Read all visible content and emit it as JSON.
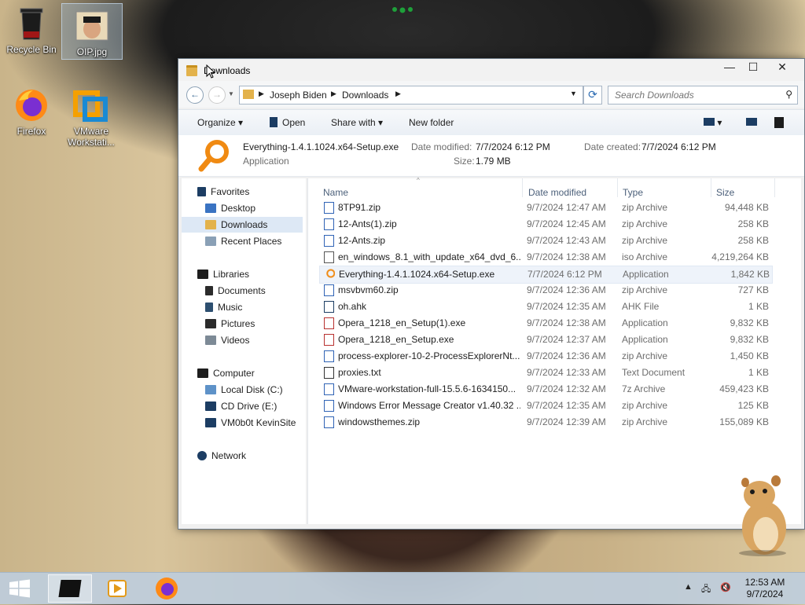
{
  "desktop": {
    "icons": [
      {
        "label": "Recycle Bin",
        "icon": "recycle-bin-icon"
      },
      {
        "label": "OIP.jpg",
        "icon": "image-file-icon"
      },
      {
        "label": "Firefox",
        "icon": "firefox-icon"
      },
      {
        "label": "VMware Workstati...",
        "icon": "vmware-icon"
      }
    ]
  },
  "window": {
    "title": "Downloads",
    "buttons": {
      "minimize": "—",
      "maximize": "☐",
      "close": "✕"
    },
    "address": {
      "segments": [
        "Joseph Biden",
        "Downloads"
      ]
    },
    "search": {
      "placeholder": "Search Downloads"
    },
    "toolbar": {
      "organize": "Organize",
      "open": "Open",
      "share_with": "Share with",
      "new_folder": "New folder"
    },
    "details": {
      "file_name": "Everything-1.4.1.1024.x64-Setup.exe",
      "file_type": "Application",
      "date_modified_label": "Date modified:",
      "date_modified": "7/7/2024 6:12 PM",
      "date_created_label": "Date created:",
      "date_created": "7/7/2024 6:12 PM",
      "size_label": "Size:",
      "size": "1.79 MB"
    },
    "nav": {
      "favorites": "Favorites",
      "desktop": "Desktop",
      "downloads": "Downloads",
      "recent_places": "Recent Places",
      "libraries": "Libraries",
      "documents": "Documents",
      "music": "Music",
      "pictures": "Pictures",
      "videos": "Videos",
      "computer": "Computer",
      "local_disk": "Local Disk (C:)",
      "cd_drive": "CD Drive (E:)",
      "share": "VM0b0t KevinSite",
      "network": "Network"
    },
    "columns": {
      "name": "Name",
      "date_modified": "Date modified",
      "type": "Type",
      "size": "Size"
    },
    "files": [
      {
        "name": "8TP91.zip",
        "date": "9/7/2024 12:47 AM",
        "type": "zip Archive",
        "size": "94,448 KB"
      },
      {
        "name": "12-Ants(1).zip",
        "date": "9/7/2024 12:45 AM",
        "type": "zip Archive",
        "size": "258 KB"
      },
      {
        "name": "12-Ants.zip",
        "date": "9/7/2024 12:43 AM",
        "type": "zip Archive",
        "size": "258 KB"
      },
      {
        "name": "en_windows_8.1_with_update_x64_dvd_6...",
        "date": "9/7/2024 12:38 AM",
        "type": "iso Archive",
        "size": "4,219,264 KB"
      },
      {
        "name": "Everything-1.4.1.1024.x64-Setup.exe",
        "date": "7/7/2024 6:12 PM",
        "type": "Application",
        "size": "1,842 KB"
      },
      {
        "name": "msvbvm60.zip",
        "date": "9/7/2024 12:36 AM",
        "type": "zip Archive",
        "size": "727 KB"
      },
      {
        "name": "oh.ahk",
        "date": "9/7/2024 12:35 AM",
        "type": "AHK File",
        "size": "1 KB"
      },
      {
        "name": "Opera_1218_en_Setup(1).exe",
        "date": "9/7/2024 12:38 AM",
        "type": "Application",
        "size": "9,832 KB"
      },
      {
        "name": "Opera_1218_en_Setup.exe",
        "date": "9/7/2024 12:37 AM",
        "type": "Application",
        "size": "9,832 KB"
      },
      {
        "name": "process-explorer-10-2-ProcessExplorerNt...",
        "date": "9/7/2024 12:36 AM",
        "type": "zip Archive",
        "size": "1,450 KB"
      },
      {
        "name": "proxies.txt",
        "date": "9/7/2024 12:33 AM",
        "type": "Text Document",
        "size": "1 KB"
      },
      {
        "name": "VMware-workstation-full-15.5.6-1634150...",
        "date": "9/7/2024 12:32 AM",
        "type": "7z Archive",
        "size": "459,423 KB"
      },
      {
        "name": "Windows Error Message Creator v1.40.32 ...",
        "date": "9/7/2024 12:35 AM",
        "type": "zip Archive",
        "size": "125 KB"
      },
      {
        "name": "windowsthemes.zip",
        "date": "9/7/2024 12:39 AM",
        "type": "zip Archive",
        "size": "155,089 KB"
      }
    ]
  },
  "taskbar": {
    "items": [
      "explorer-icon",
      "media-player-icon",
      "firefox-icon"
    ],
    "clock": {
      "time": "12:53 AM",
      "date": "9/7/2024"
    }
  },
  "colors": {
    "accent": "#2a6ab2",
    "folder": "#e3b24b",
    "selection": "#dde8f5"
  }
}
